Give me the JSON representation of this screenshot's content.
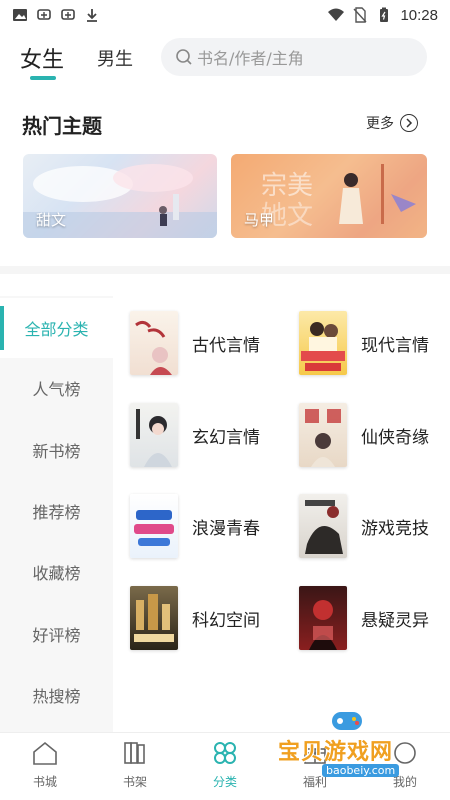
{
  "statusbar": {
    "time": "10:28"
  },
  "header": {
    "tab_female": "女生",
    "tab_male": "男生",
    "search_placeholder": "书名/作者/主角"
  },
  "hot": {
    "title": "热门主题",
    "more": "更多",
    "banners": [
      {
        "label": "甜文"
      },
      {
        "label": "马甲"
      }
    ]
  },
  "leftnav": [
    {
      "label": "全部分类",
      "active": true
    },
    {
      "label": "人气榜"
    },
    {
      "label": "新书榜"
    },
    {
      "label": "推荐榜"
    },
    {
      "label": "收藏榜"
    },
    {
      "label": "好评榜"
    },
    {
      "label": "热搜榜"
    }
  ],
  "categories": [
    {
      "name": "古代言情"
    },
    {
      "name": "现代言情"
    },
    {
      "name": "玄幻言情"
    },
    {
      "name": "仙侠奇缘"
    },
    {
      "name": "浪漫青春"
    },
    {
      "name": "游戏竞技"
    },
    {
      "name": "科幻空间"
    },
    {
      "name": "悬疑灵异"
    }
  ],
  "bottomnav": [
    {
      "label": "书城"
    },
    {
      "label": "书架"
    },
    {
      "label": "分类",
      "active": true
    },
    {
      "label": "福利"
    },
    {
      "label": "我的"
    }
  ],
  "watermark": {
    "text": "宝贝游戏网",
    "url": "baobeiy.com"
  },
  "colors": {
    "accent": "#2ab3b0",
    "nav_bg": "#f7f7f7"
  }
}
